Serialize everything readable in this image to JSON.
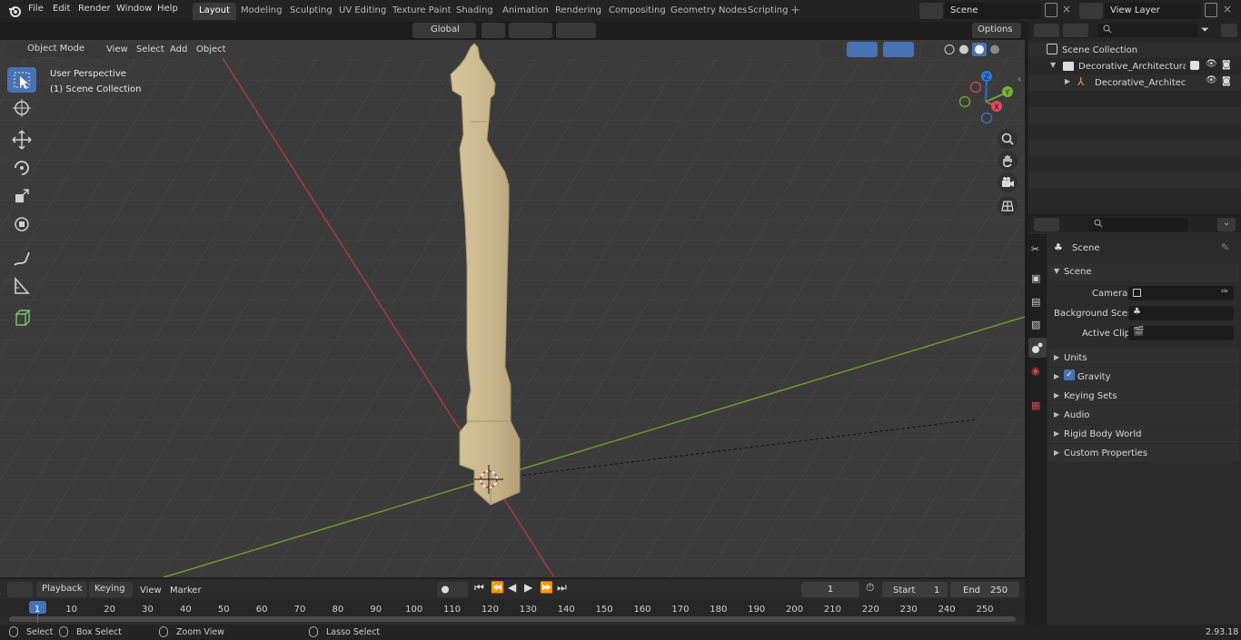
{
  "menu": [
    "File",
    "Edit",
    "Render",
    "Window",
    "Help"
  ],
  "workspaces": [
    "Layout",
    "Modeling",
    "Sculpting",
    "UV Editing",
    "Texture Paint",
    "Shading",
    "Animation",
    "Rendering",
    "Compositing",
    "Geometry Nodes",
    "Scripting"
  ],
  "active_workspace": "Layout",
  "scene_field": "Scene",
  "view_layer_field": "View Layer",
  "viewport": {
    "mode": "Object Mode",
    "menus": [
      "View",
      "Select",
      "Add",
      "Object"
    ],
    "transform_orientation": "Global",
    "options_label": "Options",
    "overlay_title": "User Perspective",
    "overlay_subtitle": "(1) Scene Collection",
    "gizmo": {
      "x": "X",
      "y": "Y",
      "z": "Z"
    }
  },
  "outliner": {
    "root": "Scene Collection",
    "items": [
      "Decorative_Architectural_Colu",
      "Decorative_Architectural_"
    ]
  },
  "properties": {
    "context": "Scene",
    "panel": "Scene",
    "camera_label": "Camera",
    "background_scene_label": "Background Scene",
    "active_clip_label": "Active Clip",
    "sections": [
      "Units",
      "Gravity",
      "Keying Sets",
      "Audio",
      "Rigid Body World",
      "Custom Properties"
    ]
  },
  "timeline": {
    "menus": [
      "Playback",
      "Keying",
      "View",
      "Marker"
    ],
    "current_frame": "1",
    "start_label": "Start",
    "start_value": "1",
    "end_label": "End",
    "end_value": "250",
    "ruler": [
      "1",
      "10",
      "20",
      "30",
      "40",
      "50",
      "60",
      "70",
      "80",
      "90",
      "100",
      "110",
      "120",
      "130",
      "140",
      "150",
      "160",
      "170",
      "180",
      "190",
      "200",
      "210",
      "220",
      "230",
      "240",
      "250"
    ]
  },
  "status": {
    "select": "Select",
    "box_select": "Box Select",
    "zoom_view": "Zoom View",
    "lasso_select": "Lasso Select",
    "version": "2.93.18"
  },
  "colors": {
    "accent": "#4772b3",
    "x_axis": "#b5424f",
    "y_axis": "#7da33a",
    "model": "#c9b78d"
  }
}
